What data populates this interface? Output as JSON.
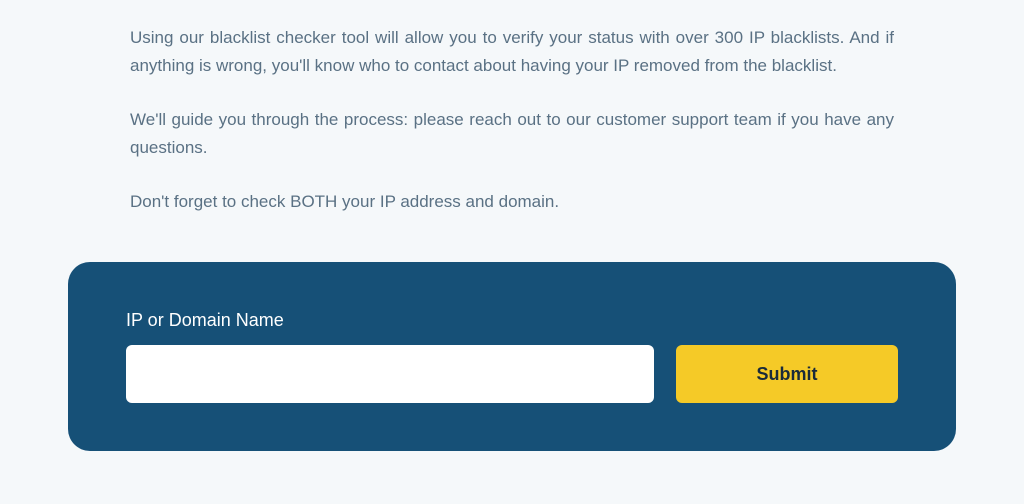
{
  "paragraphs": {
    "p1": "Using our blacklist checker tool will allow you to verify your status with over 300 IP blacklists. And if anything is wrong, you'll know who to contact about having your IP removed from the blacklist.",
    "p2": "We'll guide you through the process: please reach out to our customer support team if you have any questions.",
    "p3": "Don't forget to check BOTH your IP address and domain."
  },
  "form": {
    "label": "IP or Domain Name",
    "input_value": "",
    "submit_label": "Submit"
  }
}
